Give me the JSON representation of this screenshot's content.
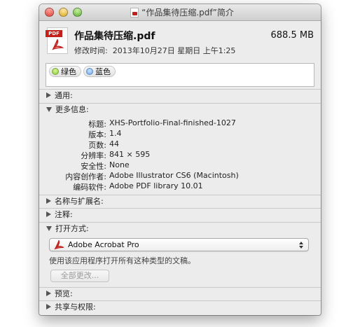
{
  "window": {
    "title": "“作品集待压缩.pdf”简介"
  },
  "header": {
    "file_name": "作品集待压缩.pdf",
    "file_size": "688.5 MB",
    "modified_label": "修改时间:",
    "modified_value": "2013年10月27日 星期日 上午1:25",
    "file_badge": "PDF"
  },
  "tags": [
    {
      "label": "绿色",
      "color": "#8ccb33"
    },
    {
      "label": "蓝色",
      "color": "#6ea6ea"
    }
  ],
  "sections": {
    "general": "通用:",
    "more_info": "更多信息:",
    "name_ext": "名称与扩展名:",
    "comments": "注释:",
    "open_with": "打开方式:",
    "preview": "预览:",
    "sharing": "共享与权限:"
  },
  "more_info": [
    {
      "key": "标题:",
      "value": "XHS-Portfolio-Final-finished-1027"
    },
    {
      "key": "版本:",
      "value": "1.4"
    },
    {
      "key": "页数:",
      "value": "44"
    },
    {
      "key": "分辨率:",
      "value": "841 × 595"
    },
    {
      "key": "安全性:",
      "value": "None"
    },
    {
      "key": "内容创作者:",
      "value": "Adobe Illustrator CS6 (Macintosh)"
    },
    {
      "key": "编码软件:",
      "value": "Adobe PDF library 10.01"
    }
  ],
  "open_with": {
    "selected_app": "Adobe Acrobat Pro",
    "hint": "使用该应用程序打开所有这种类型的文稿。",
    "change_all_label": "全部更改..."
  },
  "colors": {
    "acrobat_red": "#c2211b"
  }
}
